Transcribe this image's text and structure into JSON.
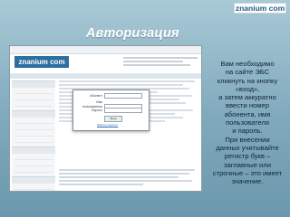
{
  "slide": {
    "logo": "znanium com",
    "title": "Авторизация",
    "note_lines": [
      "Вам необходимо",
      "на сайте ЭБС",
      "кликнуть на кнопку",
      "«вход»,",
      "а затем аккуратно",
      "ввести номер",
      "абонента, имя",
      "пользователя",
      "и пароль.",
      "При внесении",
      "данных учитывайте",
      "регистр букв –",
      "заглавные или",
      "строчные – это имеет",
      "значение."
    ]
  },
  "screenshot": {
    "brand": "znanium com",
    "login": {
      "subscriber_label": "Абонент",
      "username_label": "Имя пользователя",
      "password_label": "Пароль",
      "enter_label": "Вход",
      "forgot_label": "Забыли пароль?"
    }
  }
}
